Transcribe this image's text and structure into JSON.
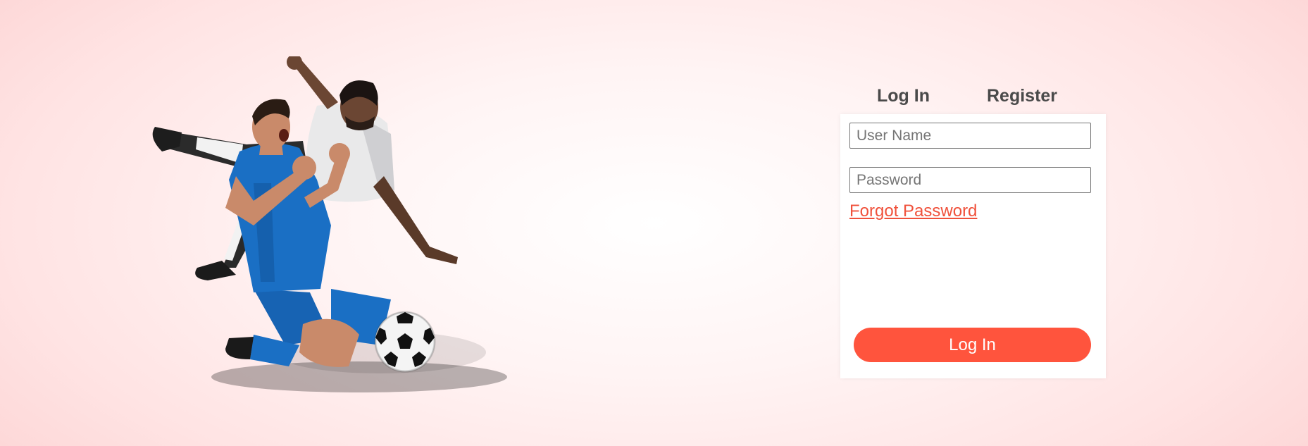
{
  "tabs": {
    "login_label": "Log In",
    "register_label": "Register"
  },
  "form": {
    "username_placeholder": "User Name",
    "password_placeholder": "Password",
    "forgot_label": "Forgot Password",
    "submit_label": "Log In"
  },
  "hero": {
    "icon": "soccer-players-illustration"
  },
  "colors": {
    "accent": "#ff543d",
    "link": "#f0513b",
    "tab_text": "#4a4a4a",
    "jersey_blue": "#1a6fc4",
    "jersey_white": "#e9e9ea"
  }
}
